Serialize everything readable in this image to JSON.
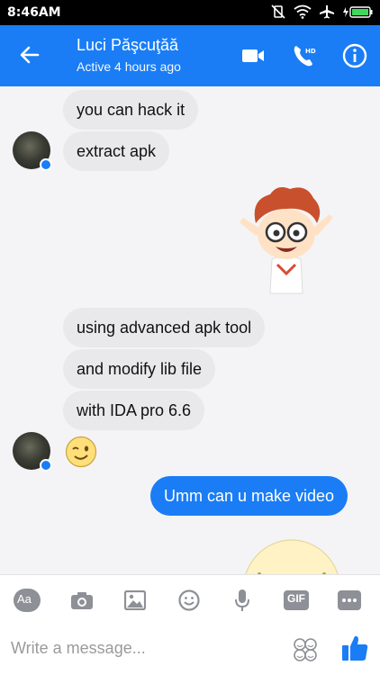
{
  "status_bar": {
    "time": "8:46AM"
  },
  "header": {
    "name": "Luci Păşcuţăă",
    "status": "Active 4 hours ago"
  },
  "messages": {
    "m1": "you can hack it",
    "m2": "extract apk",
    "m3": "using advanced apk tool",
    "m4": "and modify lib file",
    "m5": "with IDA pro 6.6",
    "m6": "Umm can u make video"
  },
  "toolbar": {
    "aa_label": "Aa",
    "gif_label": "GIF"
  },
  "compose": {
    "placeholder": "Write a message..."
  },
  "colors": {
    "brand": "#1a7df5",
    "bubble_gray": "#e9e9eb"
  },
  "icons": [
    "back-arrow-icon",
    "video-call-icon",
    "hd-call-icon",
    "info-icon",
    "camera-icon",
    "gallery-icon",
    "emoji-icon",
    "microphone-icon",
    "more-icon",
    "stickers-icon",
    "thumbs-up-icon"
  ]
}
